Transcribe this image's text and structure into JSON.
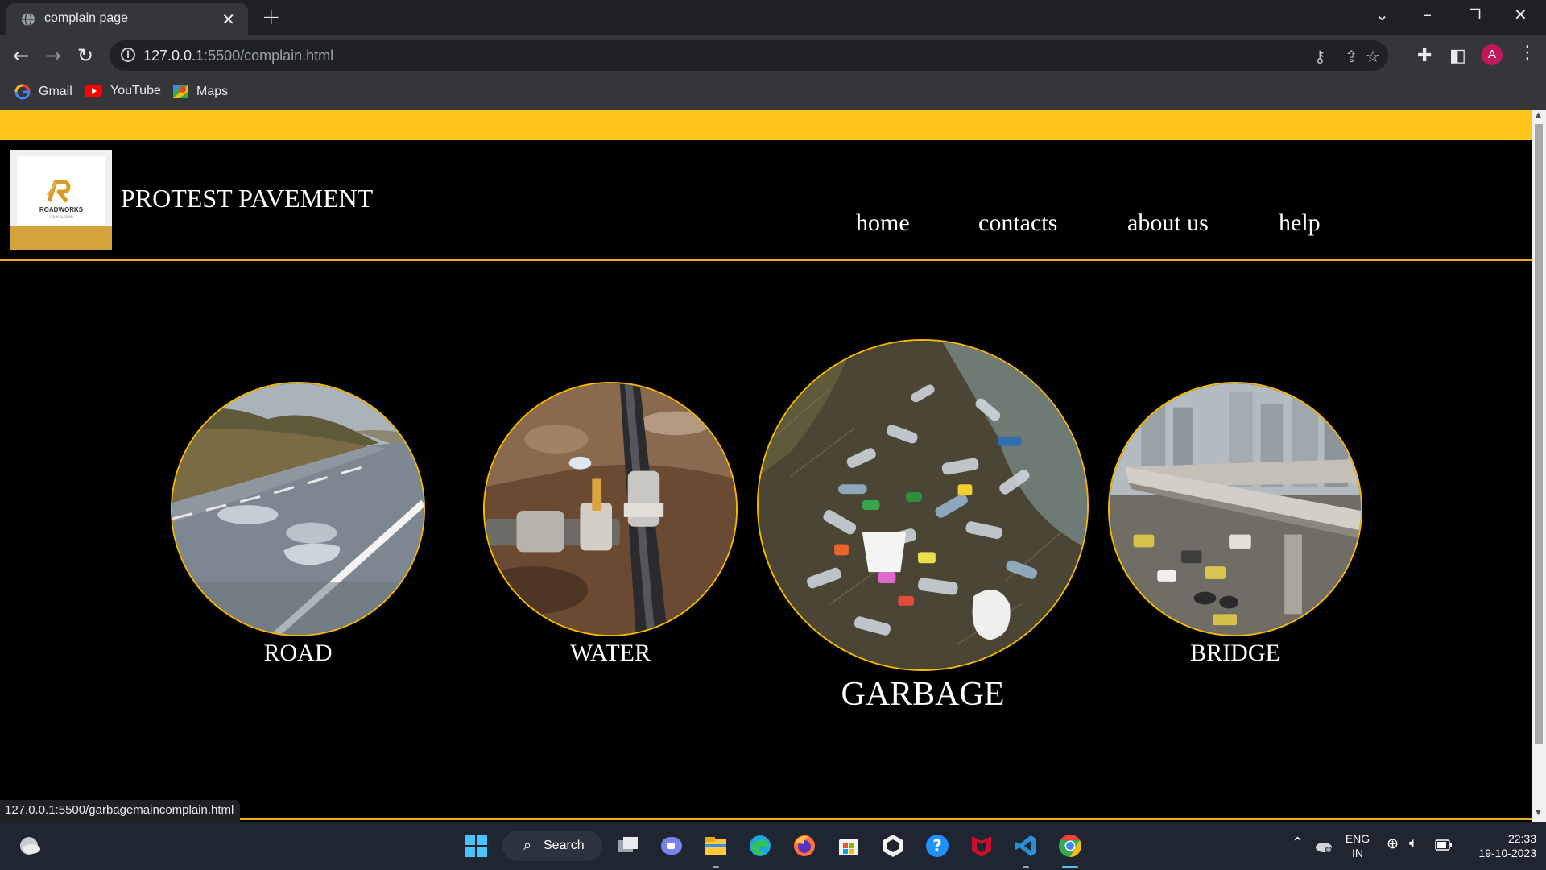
{
  "browser": {
    "tab_title": "complain page",
    "tab_close_glyph": "✕",
    "new_tab_glyph": "+",
    "url_host": "127.0.0.1",
    "url_path": ":5500/complain.html",
    "bookmarks": [
      {
        "label": "Gmail",
        "icon": "google-icon"
      },
      {
        "label": "YouTube",
        "icon": "youtube-icon"
      },
      {
        "label": "Maps",
        "icon": "maps-icon"
      }
    ],
    "avatar_letter": "A",
    "status_url": "127.0.0.1:5500/garbagemaincomplain.html"
  },
  "site": {
    "title": "PROTEST PAVEMENT",
    "logo": {
      "brand": "ROADWORKS",
      "slogan": "YOUR SLOGAN"
    },
    "nav": [
      "home",
      "contacts",
      "about us",
      "help"
    ]
  },
  "categories": [
    {
      "label": "ROAD",
      "image": "road-with-potholes"
    },
    {
      "label": "WATER",
      "image": "leaking-water-pipe"
    },
    {
      "label": "GARBAGE",
      "image": "plastic-bottle-litter",
      "hovered": true
    },
    {
      "label": "BRIDGE",
      "image": "city-flyover-bridge"
    }
  ],
  "taskbar": {
    "search_label": "Search",
    "language": "ENG",
    "region": "IN",
    "time": "22:33",
    "date": "19-10-2023"
  },
  "colors": {
    "accent_yellow": "#fec51b",
    "rule_gold": "#e8b01d",
    "page_background": "#000000",
    "chrome_dark": "#202124",
    "chrome_toolbar": "#35363a"
  }
}
